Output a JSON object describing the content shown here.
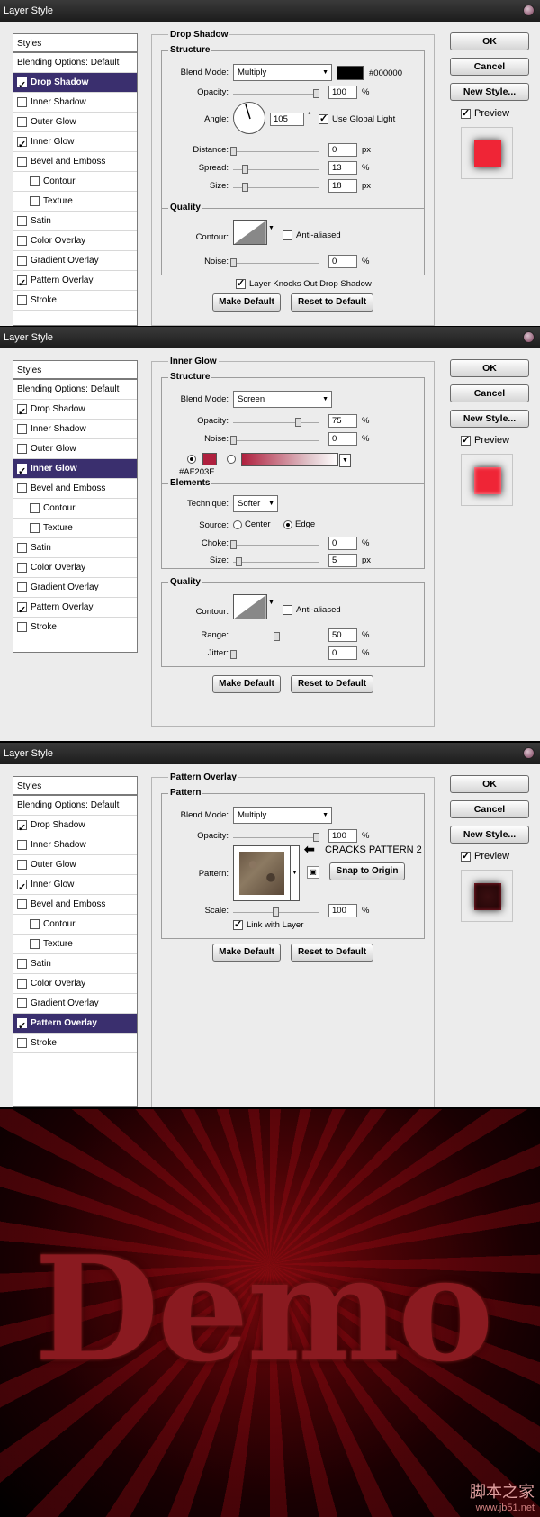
{
  "dialog_title": "Layer Style",
  "styles_header": "Styles",
  "blending_options": "Blending Options: Default",
  "style_items": [
    {
      "label": "Drop Shadow",
      "sub": false
    },
    {
      "label": "Inner Shadow",
      "sub": false
    },
    {
      "label": "Outer Glow",
      "sub": false
    },
    {
      "label": "Inner Glow",
      "sub": false
    },
    {
      "label": "Bevel and Emboss",
      "sub": false
    },
    {
      "label": "Contour",
      "sub": true
    },
    {
      "label": "Texture",
      "sub": true
    },
    {
      "label": "Satin",
      "sub": false
    },
    {
      "label": "Color Overlay",
      "sub": false
    },
    {
      "label": "Gradient Overlay",
      "sub": false
    },
    {
      "label": "Pattern Overlay",
      "sub": false
    },
    {
      "label": "Stroke",
      "sub": false
    }
  ],
  "checked_items": [
    "Drop Shadow",
    "Inner Glow",
    "Pattern Overlay"
  ],
  "buttons": {
    "ok": "OK",
    "cancel": "Cancel",
    "new_style": "New Style...",
    "preview": "Preview"
  },
  "common": {
    "make_default": "Make Default",
    "reset_default": "Reset to Default",
    "structure": "Structure",
    "quality": "Quality",
    "contour": "Contour:",
    "anti_aliased": "Anti-aliased",
    "blend_mode": "Blend Mode:",
    "opacity": "Opacity:",
    "noise": "Noise:",
    "pct": "%",
    "px": "px"
  },
  "drop_shadow": {
    "selected": "Drop Shadow",
    "title": "Drop Shadow",
    "blend_mode": "Multiply",
    "color_hex": "#000000",
    "color": "#000000",
    "opacity": "100",
    "angle_label": "Angle:",
    "angle": "105",
    "angle_unit": "°",
    "use_global_light": "Use Global Light",
    "distance_label": "Distance:",
    "distance": "0",
    "spread_label": "Spread:",
    "spread": "13",
    "size_label": "Size:",
    "size": "18",
    "noise": "0",
    "knocks_out": "Layer Knocks Out Drop Shadow"
  },
  "inner_glow": {
    "selected": "Inner Glow",
    "title": "Inner Glow",
    "blend_mode": "Screen",
    "opacity": "75",
    "noise": "0",
    "color_hex": "#AF203E",
    "color": "#AF203E",
    "elements": "Elements",
    "technique_label": "Technique:",
    "technique": "Softer",
    "source_label": "Source:",
    "source_center": "Center",
    "source_edge": "Edge",
    "choke_label": "Choke:",
    "choke": "0",
    "size_label": "Size:",
    "size": "5",
    "range_label": "Range:",
    "range": "50",
    "jitter_label": "Jitter:",
    "jitter": "0"
  },
  "pattern_overlay": {
    "selected": "Pattern Overlay",
    "title": "Pattern Overlay",
    "group": "Pattern",
    "blend_mode": "Multiply",
    "opacity": "100",
    "pattern_label": "Pattern:",
    "pattern_name": "CRACKS PATTERN 2",
    "snap_to_origin": "Snap to Origin",
    "scale_label": "Scale:",
    "scale": "100",
    "link_with_layer": "Link with Layer"
  },
  "result": {
    "text": "Demo",
    "watermark_cn": "脚本之家",
    "watermark_url": "www.jb51.net"
  }
}
